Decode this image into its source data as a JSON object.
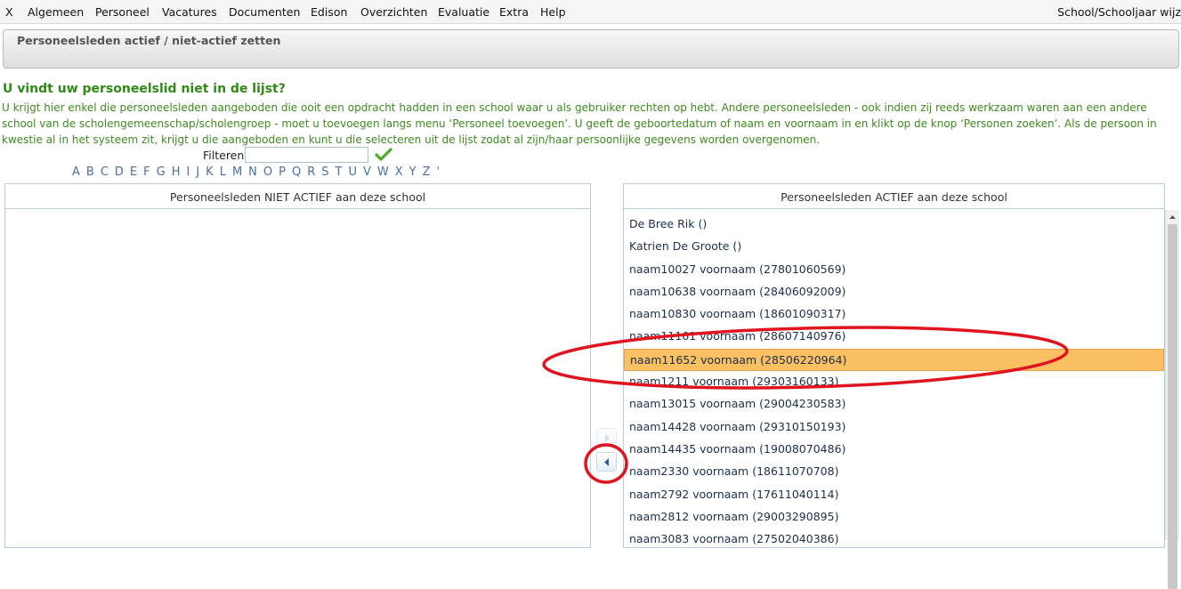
{
  "menu": {
    "items": [
      "X",
      "Algemeen",
      "Personeel",
      "Vacatures",
      "Documenten",
      "Edison",
      "Overzichten",
      "Evaluatie",
      "Extra",
      "Help"
    ],
    "right": "School/Schooljaar wijz"
  },
  "panel_title": "Personeelsleden actief / niet-actief zetten",
  "info": {
    "heading": "U vindt uw personeelslid niet in de lijst?",
    "body": "U krijgt hier enkel die personeelsleden aangeboden die ooit een opdracht hadden in een school waar u als gebruiker rechten op hebt. Andere personeelsleden - ook indien zij reeds werkzaam waren aan een andere school van de scholengemeenschap/scholengroep - moet u toevoegen langs menu ‘Personeel toevoegen’. U geeft de geboortedatum of naam en voornaam in en klikt op de knop ‘Personen zoeken’. Als de persoon in kwestie al in het systeem zit, krijgt u die aangeboden en kunt u die selecteren uit de lijst zodat al zijn/haar persoonlijke gegevens worden overgenomen."
  },
  "filter": {
    "label": "Filteren",
    "value": ""
  },
  "alphabet": [
    "A",
    "B",
    "C",
    "D",
    "E",
    "F",
    "G",
    "H",
    "I",
    "J",
    "K",
    "L",
    "M",
    "N",
    "O",
    "P",
    "Q",
    "R",
    "S",
    "T",
    "U",
    "V",
    "W",
    "X",
    "Y",
    "Z",
    "'"
  ],
  "lists": {
    "inactive": {
      "title": "Personeelsleden NIET ACTIEF aan deze school",
      "items": []
    },
    "active": {
      "title": "Personeelsleden ACTIEF aan deze school",
      "items": [
        "De Bree Rik ()",
        "Katrien De Groote ()",
        "naam10027 voornaam (27801060569)",
        "naam10638 voornaam (28406092009)",
        "naam10830 voornaam (18601090317)",
        "naam11161 voornaam (28607140976)",
        "naam11652 voornaam (28506220964)",
        "naam1211 voornaam (29303160133)",
        "naam13015 voornaam (29004230583)",
        "naam14428 voornaam (29310150193)",
        "naam14435 voornaam (19008070486)",
        "naam2330 voornaam (18611070708)",
        "naam2792 voornaam (17611040114)",
        "naam2812 voornaam (29003290895)",
        "naam3083 voornaam (27502040386)"
      ],
      "selected_index": 6
    }
  },
  "colors": {
    "selected": "#fac062",
    "heading": "#2f8a16",
    "annotation": "#e0141e"
  },
  "icons": {
    "filter_apply": "check-icon",
    "move_right": "arrow-right-icon",
    "move_left": "arrow-left-icon"
  }
}
